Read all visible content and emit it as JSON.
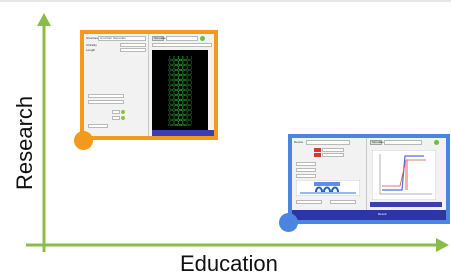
{
  "axes": {
    "x_label": "Education",
    "y_label": "Research",
    "axis_color": "#8dbb4a"
  },
  "tools": [
    {
      "name": "nanotube-tool",
      "frame_color": "#f39a1e",
      "texts": [
        "Structure",
        "Armchair Nanotube",
        "Simulate",
        "Chirality",
        "Length"
      ]
    },
    {
      "name": "device-tool",
      "frame_color": "#4a85e2",
      "texts": [
        "Device",
        "Simulate",
        "Result"
      ]
    }
  ]
}
